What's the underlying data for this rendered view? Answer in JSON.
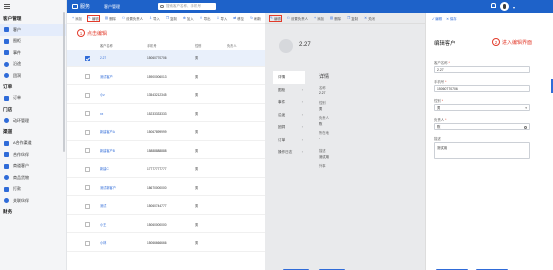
{
  "app": {
    "logo_text": "服务",
    "tab_title": "客户管理",
    "search_placeholder": "搜索客户名称、手机号"
  },
  "sidebar": {
    "groups": [
      {
        "label": "客户管理",
        "items": [
          "客户",
          "图柜",
          "事件",
          "沿途",
          "团洞"
        ]
      },
      {
        "label": "订单",
        "items": [
          "订单"
        ]
      },
      {
        "label": "门店",
        "items": [
          "动环管理"
        ]
      },
      {
        "label": "渠道",
        "items": [
          "A合作渠道",
          "合作伙伴",
          "商道客户",
          "商品货物",
          "打款",
          "关联伙伴"
        ]
      },
      {
        "label": "财务",
        "items": []
      }
    ]
  },
  "toolbar": {
    "items": [
      "添加",
      "编辑",
      "删除",
      "设置负责人",
      "导入",
      "复制",
      "加入",
      "导出",
      "导入",
      "移至",
      "刷新"
    ],
    "highlight_index": 1
  },
  "annotations": {
    "step1_num": "1",
    "step1_text": "点击编辑",
    "step2_num": "2",
    "step2_text": "进入编辑界面"
  },
  "table": {
    "columns": [
      "客户名称",
      "手机号",
      "性别",
      "负责人"
    ],
    "rows": [
      {
        "name": "2.27",
        "phone": "15060770706",
        "gender": "男",
        "selected": true
      },
      {
        "name": "测试客户",
        "phone": "15900006013",
        "gender": "男",
        "selected": false
      },
      {
        "name": "小z",
        "phone": "13543212345",
        "gender": "男",
        "selected": false
      },
      {
        "name": "xx",
        "phone": "15233333333",
        "gender": "男",
        "selected": false
      },
      {
        "name": "新建客户A",
        "phone": "15067899999",
        "gender": "男",
        "selected": false
      },
      {
        "name": "新建客户B",
        "phone": "15888888888",
        "gender": "男",
        "selected": false
      },
      {
        "name": "新建C",
        "phone": "17777777777",
        "gender": "男",
        "selected": false
      },
      {
        "name": "测试新客户",
        "phone": "18670000000",
        "gender": "男",
        "selected": false
      },
      {
        "name": "测试",
        "phone": "15060744777",
        "gender": "男",
        "selected": false
      },
      {
        "name": "小王",
        "phone": "15060000000",
        "gender": "男",
        "selected": false
      },
      {
        "name": "小林",
        "phone": "15066666666",
        "gender": "男",
        "selected": false
      }
    ]
  },
  "detail": {
    "toolbar": [
      "编辑",
      "设置负责人",
      "添加",
      "删除",
      "复制",
      "关闭"
    ],
    "name": "2.27",
    "tabs": [
      "详情",
      "图柜",
      "事件",
      "沿途",
      "团洞",
      "订单",
      "操作日志"
    ],
    "section": "详情",
    "fields": [
      {
        "label": "名称",
        "value": "2.27"
      },
      {
        "label": "性别",
        "value": "男"
      },
      {
        "label": "负责人",
        "value": "陈"
      },
      {
        "label": "所在地",
        "value": "-"
      },
      {
        "label": "描述",
        "value": "测试用"
      },
      {
        "label": "外事",
        "value": ""
      }
    ],
    "buttons": [
      "编辑",
      "关闭"
    ]
  },
  "edit": {
    "top_links": [
      "编辑",
      "保存"
    ],
    "title": "编辑客户",
    "fields": [
      {
        "label": "客户名称",
        "required": true,
        "value": "2.27",
        "kind": "text"
      },
      {
        "label": "手机号",
        "required": true,
        "value": "15060770706",
        "kind": "text"
      },
      {
        "label": "性别",
        "required": true,
        "value": "男",
        "kind": "select"
      },
      {
        "label": "负责人",
        "required": true,
        "value": "陈",
        "kind": "lookup"
      },
      {
        "label": "描述",
        "required": false,
        "value": "测试用",
        "kind": "textarea"
      }
    ],
    "buttons": [
      "保存",
      "取消"
    ]
  },
  "colors": {
    "brand": "#1e62c9",
    "accent": "#2f6bd8",
    "annotation": "#e23b2b"
  }
}
